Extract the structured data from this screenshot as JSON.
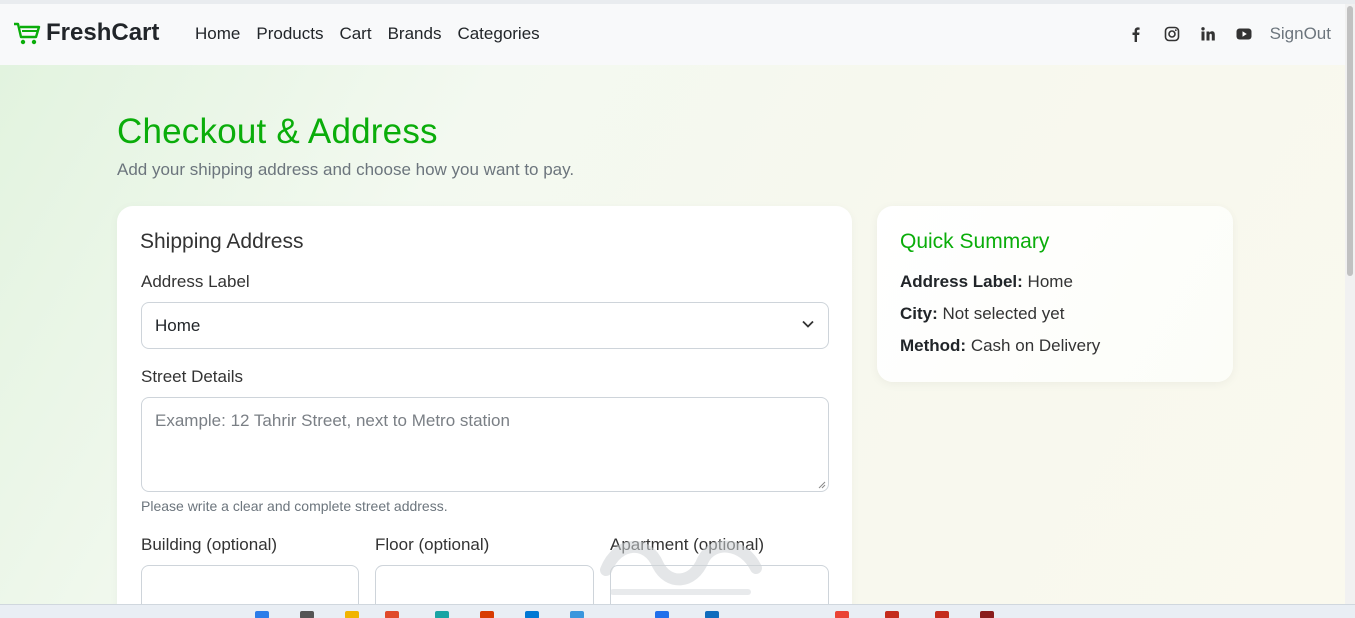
{
  "navbar": {
    "brand": "FreshCart",
    "links": [
      "Home",
      "Products",
      "Cart",
      "Brands",
      "Categories"
    ],
    "social_icons": [
      "facebook-icon",
      "instagram-icon",
      "linkedin-icon",
      "youtube-icon"
    ],
    "signout": "SignOut"
  },
  "page": {
    "title": "Checkout & Address",
    "subtitle": "Add your shipping address and choose how you want to pay."
  },
  "shipping": {
    "title": "Shipping Address",
    "address_label": {
      "label": "Address Label",
      "value": "Home"
    },
    "street": {
      "label": "Street Details",
      "placeholder": "Example: 12 Tahrir Street, next to Metro station",
      "help": "Please write a clear and complete street address."
    },
    "building_label": "Building (optional)",
    "floor_label": "Floor (optional)",
    "apartment_label": "Apartment (optional)"
  },
  "summary": {
    "title": "Quick Summary",
    "address_label_key": "Address Label:",
    "address_label_value": "Home",
    "city_key": "City:",
    "city_value": "Not selected yet",
    "method_key": "Method:",
    "method_value": "Cash on Delivery"
  },
  "colors": {
    "accent": "#0aad0a",
    "text": "#212529",
    "muted": "#6c757d"
  }
}
